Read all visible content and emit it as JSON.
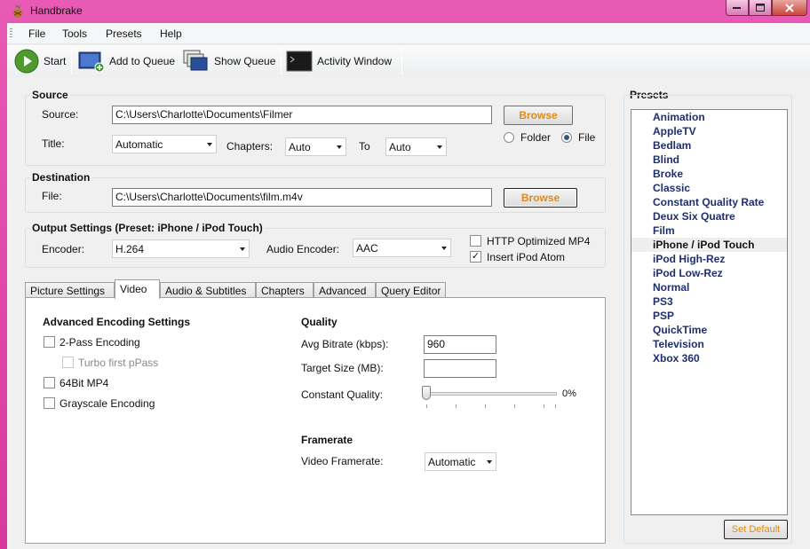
{
  "window": {
    "title": "Handbrake"
  },
  "menu": [
    "File",
    "Tools",
    "Presets",
    "Help"
  ],
  "toolbar": {
    "start": "Start",
    "add_to_queue": "Add to Queue",
    "show_queue": "Show Queue",
    "activity_window": "Activity Window"
  },
  "source": {
    "section_title": "Source",
    "source_label": "Source:",
    "source_value": "C:\\Users\\Charlotte\\Documents\\Filmer",
    "browse": "Browse",
    "title_label": "Title:",
    "title_value": "Automatic",
    "chapters_label": "Chapters:",
    "chapters_from": "Auto",
    "to_label": "To",
    "chapters_to": "Auto",
    "folder_label": "Folder",
    "file_label": "File",
    "selected_mode": "File"
  },
  "destination": {
    "section_title": "Destination",
    "file_label": "File:",
    "file_value": "C:\\Users\\Charlotte\\Documents\\film.m4v",
    "browse": "Browse"
  },
  "output": {
    "section_title": "Output Settings (Preset: iPhone / iPod Touch)",
    "encoder_label": "Encoder:",
    "encoder_value": "H.264",
    "audio_encoder_label": "Audio Encoder:",
    "audio_encoder_value": "AAC",
    "http_optimized": {
      "label": "HTTP Optimized MP4",
      "checked": false
    },
    "insert_ipod_atom": {
      "label": "Insert iPod Atom",
      "checked": true
    }
  },
  "tabs": [
    {
      "label": "Picture Settings",
      "active": false
    },
    {
      "label": "Video",
      "active": true
    },
    {
      "label": "Audio & Subtitles",
      "active": false
    },
    {
      "label": "Chapters",
      "active": false
    },
    {
      "label": "Advanced",
      "active": false
    },
    {
      "label": "Query Editor",
      "active": false
    }
  ],
  "video": {
    "advanced_title": "Advanced Encoding Settings",
    "two_pass": "2-Pass Encoding",
    "turbo": "Turbo first pPass",
    "mp4_64bit": "64Bit MP4",
    "grayscale": "Grayscale Encoding",
    "quality_title": "Quality",
    "avg_bitrate_label": "Avg Bitrate (kbps):",
    "avg_bitrate_value": "960",
    "target_size_label": "Target Size (MB):",
    "target_size_value": "",
    "constant_quality_label": "Constant Quality:",
    "constant_quality_value": "0%",
    "framerate_title": "Framerate",
    "video_framerate_label": "Video Framerate:",
    "video_framerate_value": "Automatic"
  },
  "presets": {
    "title": "Presets",
    "items": [
      "Animation",
      "AppleTV",
      "Bedlam",
      "Blind",
      "Broke",
      "Classic",
      "Constant Quality Rate",
      "Deux Six Quatre",
      "Film",
      "iPhone / iPod Touch",
      "iPod High-Rez",
      "iPod Low-Rez",
      "Normal",
      "PS3",
      "PSP",
      "QuickTime",
      "Television",
      "Xbox 360"
    ],
    "selected": "iPhone / iPod Touch",
    "set_default": "Set Default"
  },
  "colors": {
    "accent_button_text": "#e08a17",
    "preset_text": "#1e2f6e",
    "window_frame": "#d93fa2"
  }
}
